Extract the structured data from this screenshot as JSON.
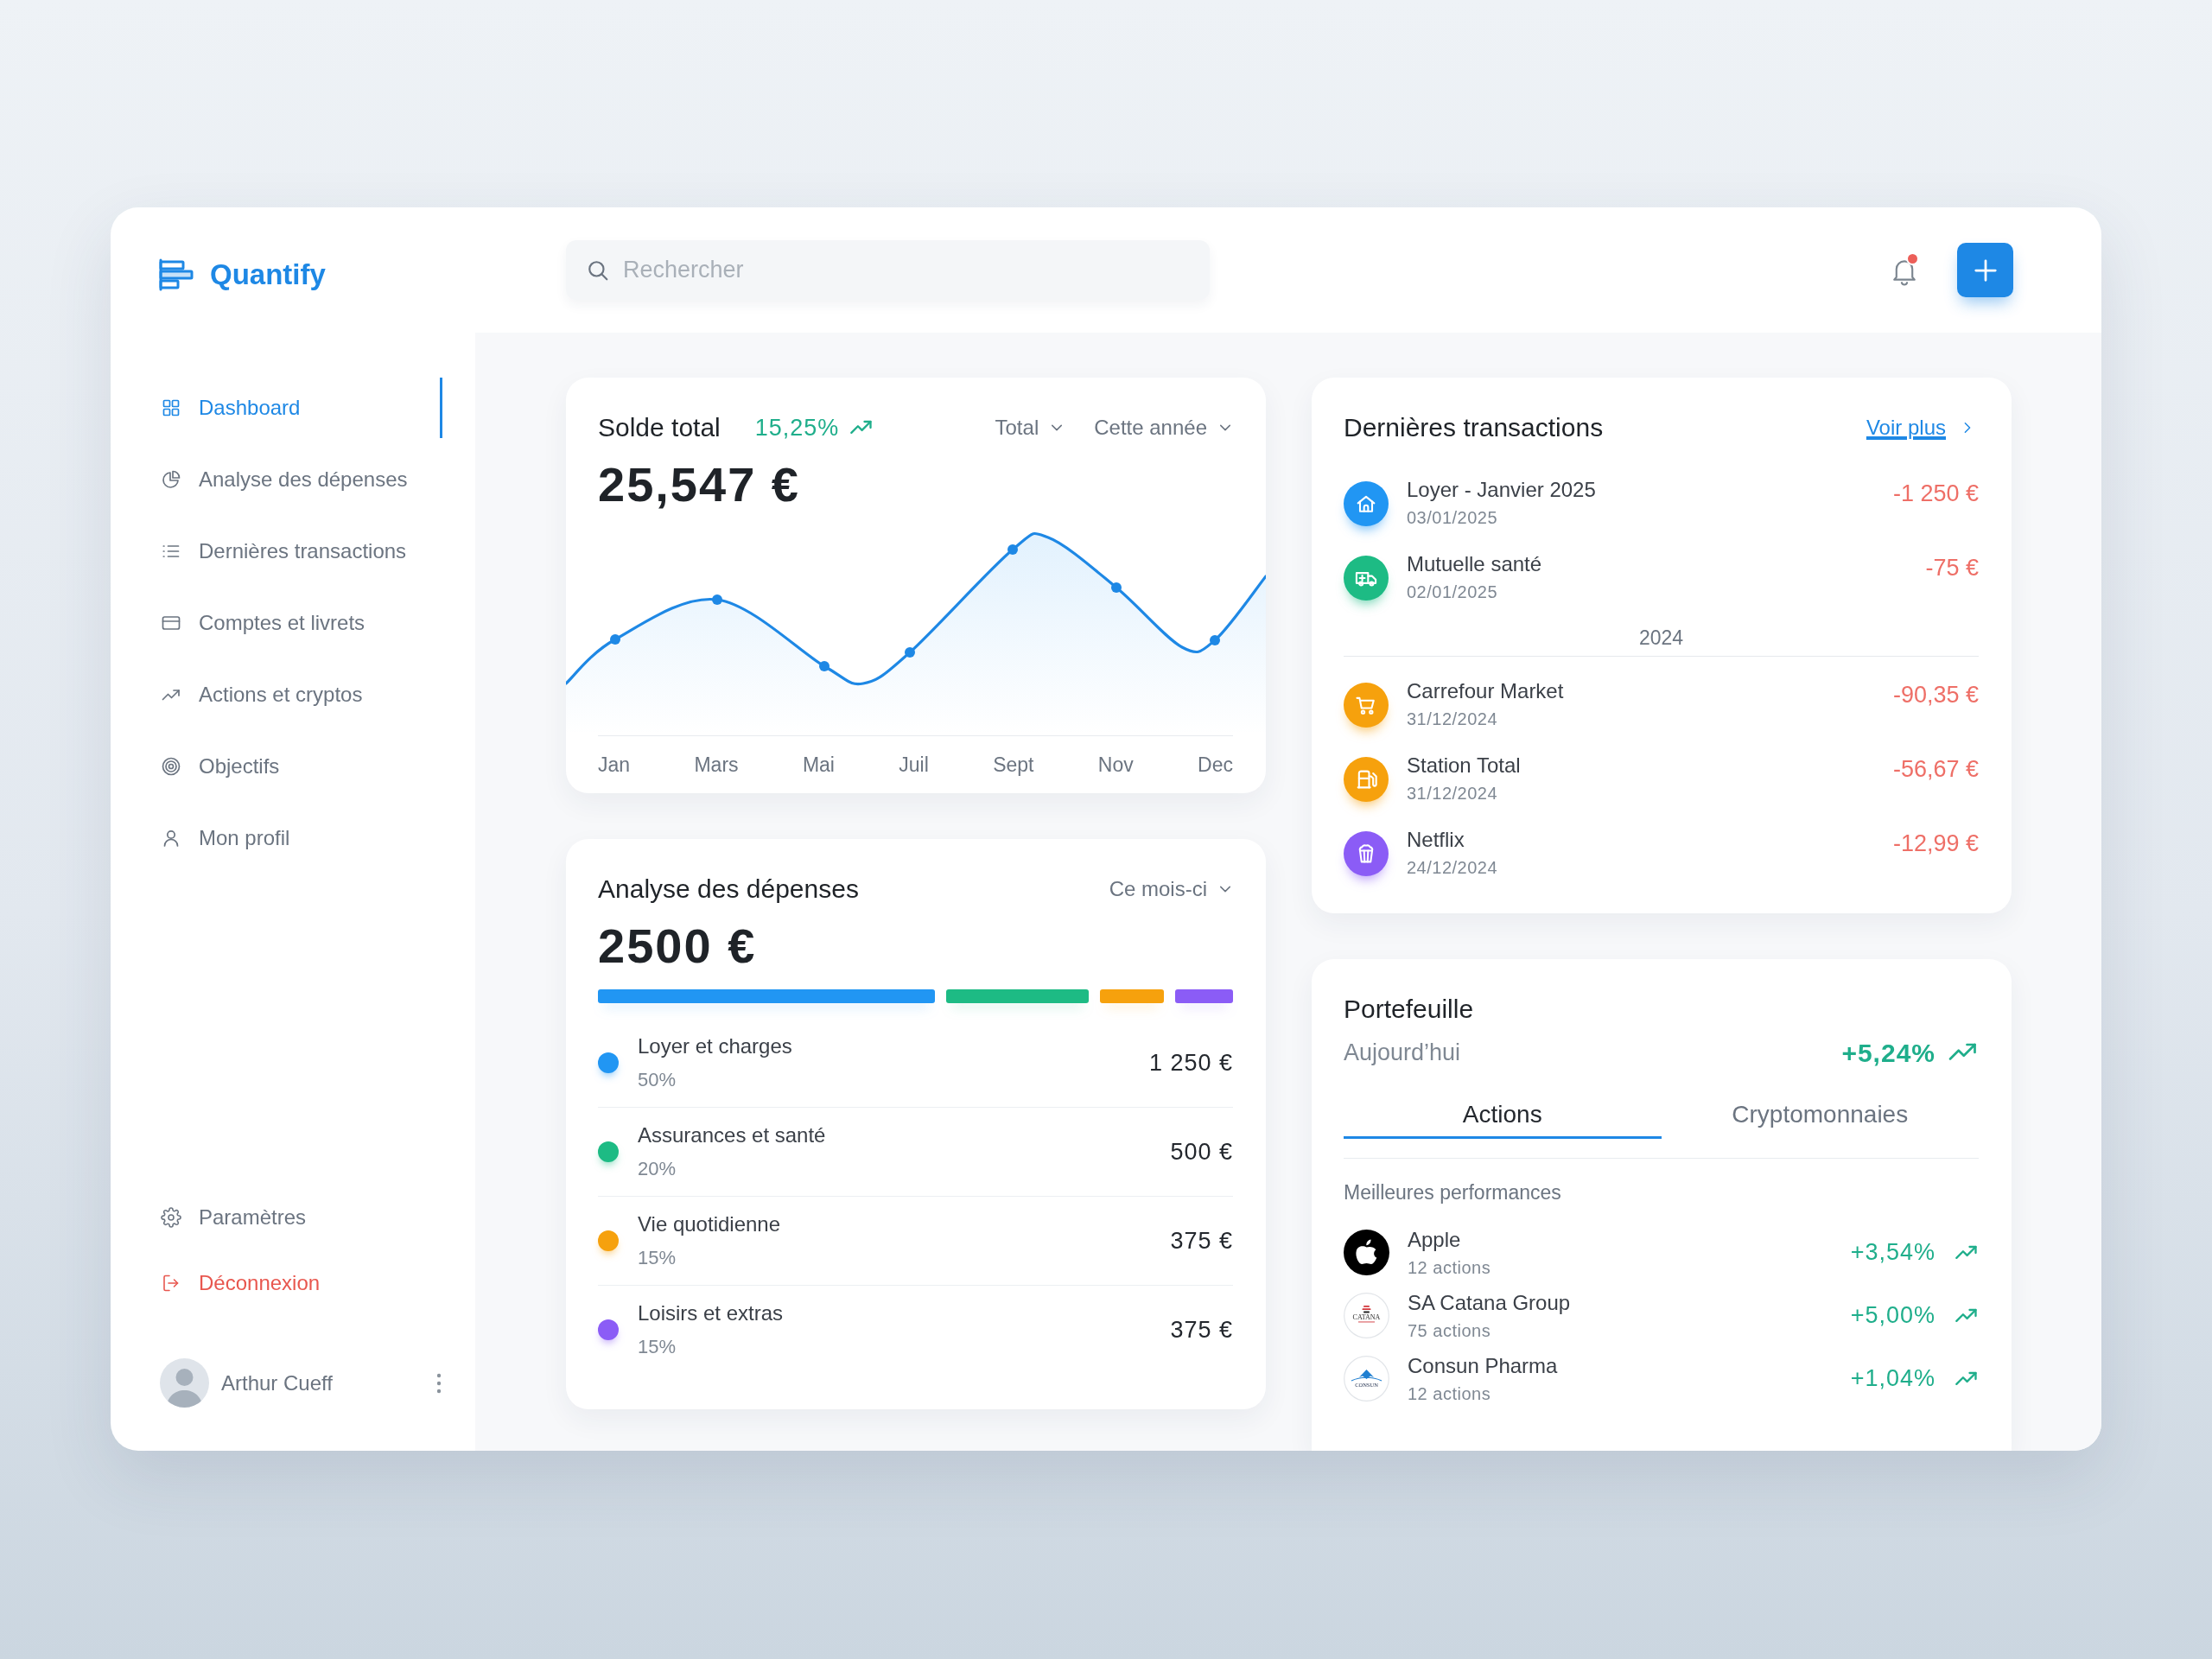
{
  "header": {
    "logo_text": "Quantify",
    "search": {
      "placeholder": "Rechercher"
    },
    "notifications": {
      "unread": true
    }
  },
  "sidebar": {
    "items": [
      {
        "label": "Dashboard",
        "selected": true
      },
      {
        "label": "Analyse des dépenses",
        "selected": false
      },
      {
        "label": "Dernières transactions",
        "selected": false
      },
      {
        "label": "Comptes et livrets",
        "selected": false
      },
      {
        "label": "Actions et cryptos",
        "selected": false
      },
      {
        "label": "Objectifs",
        "selected": false
      },
      {
        "label": "Mon profil",
        "selected": false
      }
    ],
    "footer_items": [
      {
        "label": "Paramètres",
        "kind": "settings"
      },
      {
        "label": "Déconnexion",
        "kind": "logout"
      }
    ],
    "user": {
      "name": "Arthur Cueff"
    }
  },
  "balance_card": {
    "title": "Solde total",
    "change": "15,25%",
    "filters": [
      "Total",
      "Cette année"
    ],
    "amount": "25,547 €",
    "x_labels": [
      "Jan",
      "Mars",
      "Mai",
      "Juil",
      "Sept",
      "Nov",
      "Dec"
    ]
  },
  "spending_card": {
    "title": "Analyse des dépenses",
    "filter": "Ce mois-ci",
    "amount": "2500 €",
    "categories": [
      {
        "name": "Loyer et charges",
        "share": "50%",
        "amount": "1 250 €",
        "color": "#2196f3"
      },
      {
        "name": "Assurances et santé",
        "share": "20%",
        "amount": "500 €",
        "color": "#1dbb84"
      },
      {
        "name": "Vie quotidienne",
        "share": "15%",
        "amount": "375 €",
        "color": "#f6a10d"
      },
      {
        "name": "Loisirs et extras",
        "share": "15%",
        "amount": "375 €",
        "color": "#8b5cf6"
      }
    ]
  },
  "transactions_card": {
    "title": "Dernières transactions",
    "link": "Voir plus",
    "items": [
      {
        "kind": "transaction",
        "name": "Loyer - Janvier 2025",
        "date": "03/01/2025",
        "amount": "-1 250 €",
        "color": "#2196f3"
      },
      {
        "kind": "transaction",
        "name": "Mutuelle santé",
        "date": "02/01/2025",
        "amount": "-75 €",
        "color": "#1dbb84"
      },
      {
        "kind": "divider",
        "label": "2024"
      },
      {
        "kind": "transaction",
        "name": "Carrefour Market",
        "date": "31/12/2024",
        "amount": "-90,35 €",
        "color": "#f6a10d"
      },
      {
        "kind": "transaction",
        "name": "Station Total",
        "date": "31/12/2024",
        "amount": "-56,67 €",
        "color": "#f6a10d"
      },
      {
        "kind": "transaction",
        "name": "Netflix",
        "date": "24/12/2024",
        "amount": "-12,99 €",
        "color": "#8b5cf6"
      }
    ]
  },
  "portfolio_card": {
    "title": "Portefeuille",
    "period": "Aujourd’hui",
    "change": "+5,24%",
    "tabs": [
      {
        "label": "Actions",
        "selected": true
      },
      {
        "label": "Cryptomonnaies",
        "selected": false
      }
    ],
    "section_title": "Meilleures performances",
    "stocks": [
      {
        "name": "Apple",
        "shares": "12 actions",
        "change": "+3,54%"
      },
      {
        "name": "SA Catana Group",
        "shares": "75 actions",
        "change": "+5,00%",
        "logo_text": "CATANA"
      },
      {
        "name": "Consun Pharma",
        "shares": "12 actions",
        "change": "+1,04%",
        "logo_text": "CONSUN"
      }
    ]
  }
}
